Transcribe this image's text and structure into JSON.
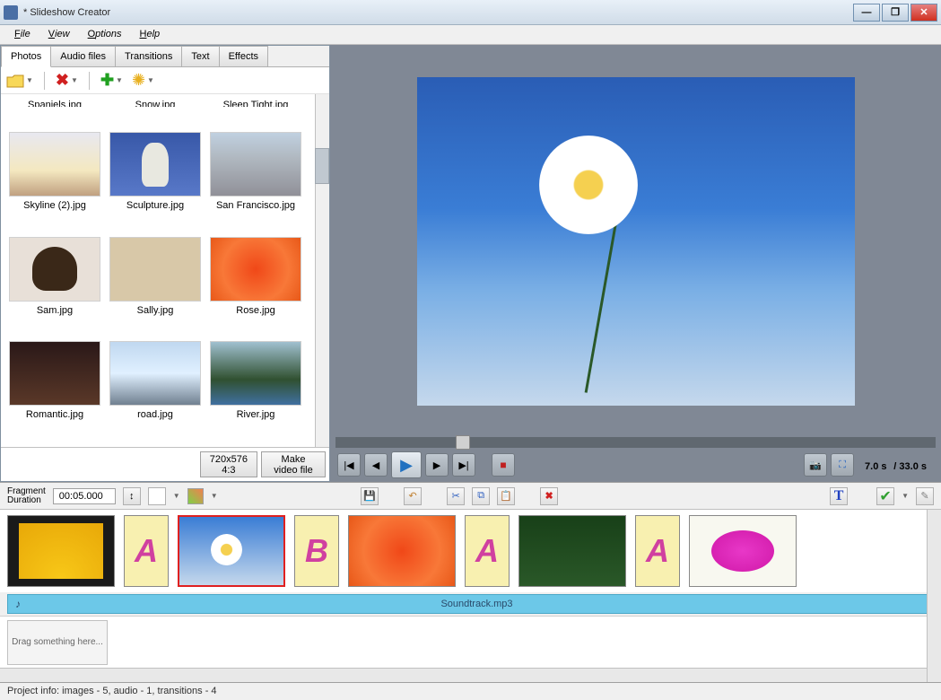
{
  "window": {
    "title": "*  Slideshow Creator"
  },
  "menu": {
    "items": [
      "File",
      "View",
      "Options",
      "Help"
    ]
  },
  "tabs": {
    "items": [
      "Photos",
      "Audio files",
      "Transitions",
      "Text",
      "Effects"
    ],
    "active": 0
  },
  "photos": [
    {
      "label": "Spaniels.jpg",
      "class": "thumb-sam",
      "cropped": true
    },
    {
      "label": "Snow.jpg",
      "class": "thumb-road",
      "cropped": true
    },
    {
      "label": "Sleep Tight.jpg",
      "class": "thumb-skyline",
      "cropped": true
    },
    {
      "label": "Skyline (2).jpg",
      "class": "thumb-skyline"
    },
    {
      "label": "Sculpture.jpg",
      "class": "thumb-sculpture"
    },
    {
      "label": "San Francisco.jpg",
      "class": "thumb-sanfran"
    },
    {
      "label": "Sam.jpg",
      "class": "thumb-sam"
    },
    {
      "label": "Sally.jpg",
      "class": "thumb-sally"
    },
    {
      "label": "Rose.jpg",
      "class": "thumb-rose"
    },
    {
      "label": "Romantic.jpg",
      "class": "thumb-romantic"
    },
    {
      "label": "road.jpg",
      "class": "thumb-road"
    },
    {
      "label": "River.jpg",
      "class": "thumb-river"
    }
  ],
  "resolution": {
    "size": "720x576",
    "ratio": "4:3"
  },
  "make_video": "Make video file",
  "playback": {
    "current": "7.0 s",
    "total": "/ 33.0 s"
  },
  "fragment": {
    "label": "Fragment Duration",
    "value": "00:05.000"
  },
  "timeline": {
    "items": [
      {
        "type": "photo",
        "class": "thumb-yellow",
        "selected": false
      },
      {
        "type": "trans",
        "letter": "A"
      },
      {
        "type": "photo",
        "class": "thumb-daisy",
        "selected": true
      },
      {
        "type": "trans",
        "letter": "B"
      },
      {
        "type": "photo",
        "class": "thumb-rose",
        "selected": false
      },
      {
        "type": "trans",
        "letter": "A"
      },
      {
        "type": "photo",
        "class": "thumb-green",
        "selected": false
      },
      {
        "type": "trans",
        "letter": "A"
      },
      {
        "type": "photo",
        "class": "thumb-pink",
        "selected": false
      }
    ],
    "audio": "Soundtrack.mp3",
    "dropzone": "Drag something here..."
  },
  "status": "Project info: images - 5, audio - 1, transitions - 4"
}
